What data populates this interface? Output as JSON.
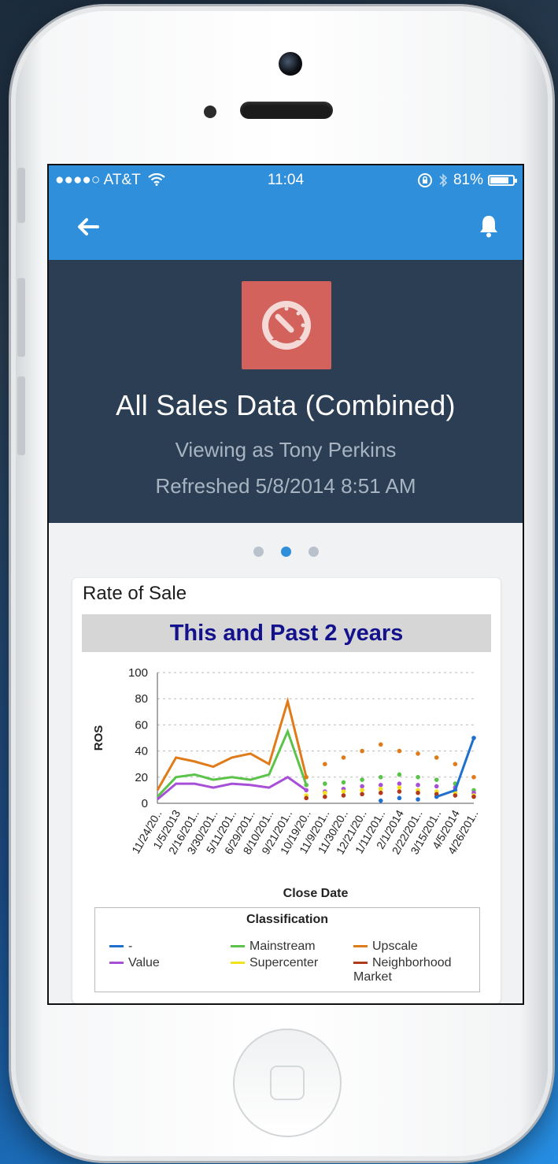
{
  "status": {
    "carrier": "●●●●○ AT&T",
    "time": "11:04",
    "battery": "81%"
  },
  "hero": {
    "title": "All Sales Data (Combined)",
    "viewing": "Viewing as Tony Perkins",
    "refreshed": "Refreshed 5/8/2014 8:51 AM"
  },
  "pager": {
    "pages": 3,
    "active": 1
  },
  "card": {
    "title": "Rate of Sale",
    "chart_heading": "This and Past 2 years"
  },
  "chart_data": {
    "type": "line",
    "title": "This and Past 2 years",
    "xlabel": "Close Date",
    "ylabel": "ROS",
    "ylim": [
      0,
      100
    ],
    "yticks": [
      0,
      20,
      40,
      60,
      80,
      100
    ],
    "categories": [
      "11/24/20..",
      "1/5/2013",
      "2/16/201..",
      "3/30/201..",
      "5/11/201..",
      "6/29/201..",
      "8/10/201..",
      "9/21/201..",
      "10/19/20..",
      "11/9/201..",
      "11/30/20..",
      "12/21/20..",
      "1/11/201..",
      "2/1/2014",
      "2/22/201..",
      "3/15/201..",
      "4/5/2014",
      "4/26/201.."
    ],
    "legend_title": "Classification",
    "series": [
      {
        "name": "-",
        "color": "#1f6fcf",
        "values": [
          null,
          null,
          null,
          null,
          null,
          null,
          null,
          null,
          null,
          null,
          null,
          null,
          2,
          4,
          3,
          5,
          10,
          50
        ]
      },
      {
        "name": "Mainstream",
        "color": "#5bc24a",
        "values": [
          5,
          20,
          22,
          18,
          20,
          18,
          22,
          55,
          14,
          15,
          16,
          18,
          20,
          22,
          20,
          18,
          15,
          10
        ]
      },
      {
        "name": "Upscale",
        "color": "#e07b1a",
        "values": [
          10,
          35,
          32,
          28,
          35,
          38,
          30,
          78,
          20,
          30,
          35,
          40,
          45,
          40,
          38,
          35,
          30,
          20
        ]
      },
      {
        "name": "Value",
        "color": "#a84fd8",
        "values": [
          3,
          15,
          15,
          12,
          15,
          14,
          12,
          20,
          10,
          9,
          11,
          13,
          14,
          15,
          14,
          13,
          12,
          8
        ]
      },
      {
        "name": "Supercenter",
        "color": "#f2e21a",
        "values": [
          null,
          null,
          null,
          null,
          null,
          null,
          null,
          null,
          6,
          8,
          9,
          10,
          11,
          12,
          10,
          9,
          8,
          6
        ]
      },
      {
        "name": "Neighborhood Market",
        "color": "#b23a1c",
        "values": [
          null,
          null,
          null,
          null,
          null,
          null,
          null,
          null,
          4,
          5,
          6,
          7,
          8,
          9,
          8,
          7,
          6,
          5
        ]
      }
    ]
  }
}
